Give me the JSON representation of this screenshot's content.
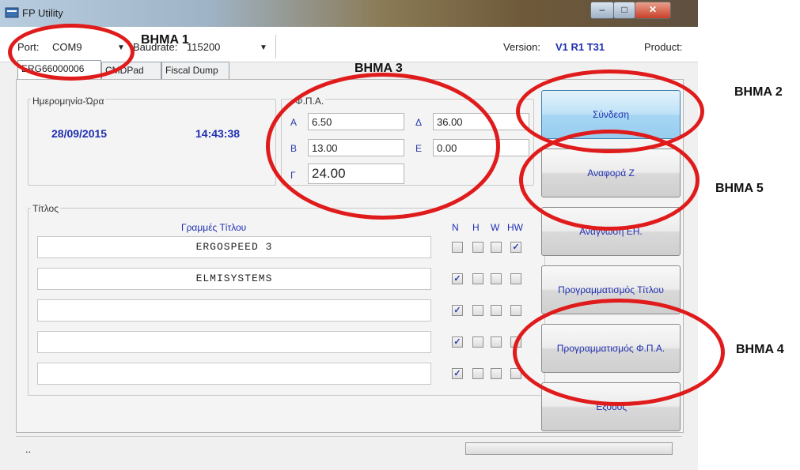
{
  "window": {
    "title": "FP Utility"
  },
  "toolbar": {
    "port_label": "Port:",
    "port_value": "COM9",
    "baud_label": "Baudrate:",
    "baud_value": "115200",
    "version_label": "Version:",
    "version_value": "V1 R1 T31",
    "product_label": "Product:"
  },
  "tabs": [
    {
      "label": "ERG66000006"
    },
    {
      "label": "CMDPad"
    },
    {
      "label": "Fiscal Dump"
    }
  ],
  "datetime": {
    "group_title": "Ημερομηνία-Ώρα",
    "date": "28/09/2015",
    "time": "14:43:38"
  },
  "vat": {
    "group_title": "Φ.Π.Α.",
    "rates": [
      {
        "letter": "A",
        "value": "6.50"
      },
      {
        "letter": "B",
        "value": "13.00"
      },
      {
        "letter": "Γ",
        "value": "24.00"
      },
      {
        "letter": "Δ",
        "value": "36.00"
      },
      {
        "letter": "E",
        "value": "0.00"
      }
    ]
  },
  "titles": {
    "group_title": "Τίτλος",
    "header": "Γραμμές Τίτλου",
    "flag_headers": [
      "N",
      "H",
      "W",
      "HW"
    ],
    "lines": [
      {
        "text": "ERGOSPEED 3",
        "flags": [
          false,
          false,
          false,
          true
        ]
      },
      {
        "text": "ELMISYSTEMS",
        "flags": [
          true,
          false,
          false,
          false
        ]
      },
      {
        "text": "",
        "flags": [
          true,
          false,
          false,
          false
        ]
      },
      {
        "text": "",
        "flags": [
          true,
          false,
          false,
          false
        ]
      },
      {
        "text": "",
        "flags": [
          true,
          false,
          false,
          false
        ]
      }
    ]
  },
  "buttons": {
    "connect": "Σύνδεση",
    "z_report": "Αναφορά Ζ",
    "read_ej": "Ανάγνωση ΕΗ.",
    "program_title": "Προγραμματισμός Τίτλου",
    "program_vat": "Προγραμματισμός Φ.Π.Α.",
    "exit": "Έξοδος"
  },
  "status": {
    "text": ".."
  },
  "annotations": {
    "step1": "BHMA 1",
    "step2": "BHMA 2",
    "step3": "BHMA 3",
    "step4": "BHMA 4",
    "step5": "BHMA 5"
  },
  "colors": {
    "annotation_red": "#e01b1b",
    "value_blue": "#1f2fb0",
    "accent_button": "#a6d6f3"
  },
  "icons": {
    "app": "app-window-icon",
    "minimize": "minimize-icon",
    "maximize": "maximize-icon",
    "close": "close-icon"
  }
}
